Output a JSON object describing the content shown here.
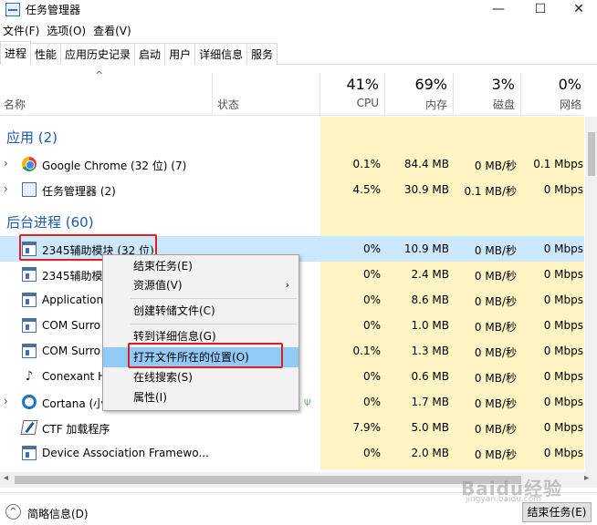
{
  "window": {
    "title": "任务管理器",
    "minimize": "—",
    "maximize": "☐",
    "close": "✕"
  },
  "menubar": [
    "文件(F)",
    "选项(O)",
    "查看(V)"
  ],
  "tabs": [
    "进程",
    "性能",
    "应用历史记录",
    "启动",
    "用户",
    "详细信息",
    "服务"
  ],
  "active_tab": "进程",
  "header": {
    "sort_arrow": "^",
    "name": "名称",
    "status": "状态",
    "metrics": [
      {
        "pct": "41%",
        "label": "CPU"
      },
      {
        "pct": "69%",
        "label": "内存"
      },
      {
        "pct": "3%",
        "label": "磁盘"
      },
      {
        "pct": "0%",
        "label": "网络"
      }
    ]
  },
  "groups": {
    "apps": "应用 (2)",
    "background": "后台进程 (60)"
  },
  "apps": [
    {
      "name": "Google Chrome (32 位) (7)",
      "icon": "chrome-icon",
      "expander": "›",
      "cpu": "0.1%",
      "mem": "84.4 MB",
      "disk": "0 MB/秒",
      "net": "0.1 Mbps"
    },
    {
      "name": "任务管理器 (2)",
      "icon": "task-manager-icon",
      "expander": "›",
      "cpu": "4.5%",
      "mem": "30.9 MB",
      "disk": "0.1 MB/秒",
      "net": "0 Mbps"
    }
  ],
  "background": [
    {
      "name": "2345辅助模块 (32 位)",
      "icon": "window-icon",
      "cpu": "0%",
      "mem": "10.9 MB",
      "disk": "0 MB/秒",
      "net": "0 Mbps",
      "selected": true
    },
    {
      "name": "2345辅助模",
      "icon": "window-icon",
      "cpu": "0%",
      "mem": "2.4 MB",
      "disk": "0 MB/秒",
      "net": "0 Mbps"
    },
    {
      "name": "Application",
      "icon": "window-icon",
      "cpu": "0%",
      "mem": "8.6 MB",
      "disk": "0 MB/秒",
      "net": "0 Mbps"
    },
    {
      "name": "COM Surro",
      "icon": "window-icon",
      "cpu": "0%",
      "mem": "1.0 MB",
      "disk": "0 MB/秒",
      "net": "0 Mbps"
    },
    {
      "name": "COM Surro",
      "icon": "window-icon",
      "cpu": "0.1%",
      "mem": "1.3 MB",
      "disk": "0 MB/秒",
      "net": "0 Mbps"
    },
    {
      "name": "Conexant H",
      "icon": "audio-icon",
      "cpu": "0%",
      "mem": "0.6 MB",
      "disk": "0 MB/秒",
      "net": "0 Mbps"
    },
    {
      "name": "Cortana (小",
      "icon": "cortana-icon",
      "expander": "›",
      "cpu": "0%",
      "mem": "1.7 MB",
      "disk": "0 MB/秒",
      "net": "0 Mbps",
      "status_leaf": "⍦"
    },
    {
      "name": "CTF 加载程序",
      "icon": "ctf-icon",
      "cpu": "7.9%",
      "mem": "5.0 MB",
      "disk": "0 MB/秒",
      "net": "0 Mbps"
    },
    {
      "name": "Device Association Framewo...",
      "icon": "window-icon",
      "cpu": "0%",
      "mem": "2.0 MB",
      "disk": "0 MB/秒",
      "net": "0 Mbps"
    }
  ],
  "context_menu": {
    "items": [
      "结束任务(E)",
      "资源值(V)",
      "创建转储文件(C)",
      "转到详细信息(G)",
      "打开文件所在的位置(O)",
      "在线搜索(S)",
      "属性(I)"
    ],
    "submenu_arrow": "›",
    "highlighted": "打开文件所在的位置(O)"
  },
  "scroll": {
    "left": "◂",
    "right": "▸"
  },
  "footer": {
    "collapse_icon": "^",
    "summary": "简略信息(D)",
    "end_task": "结束任务(E)"
  },
  "watermark": {
    "main": "Baidu经验",
    "sub": "jingyan.baidu.com"
  },
  "colors": {
    "accent": "#1e5cb3",
    "cpu_bg": "#fff4c4",
    "selected_row": "#cce8ff",
    "highlight_menu": "#91c9f7",
    "red_box": "#e02020"
  }
}
